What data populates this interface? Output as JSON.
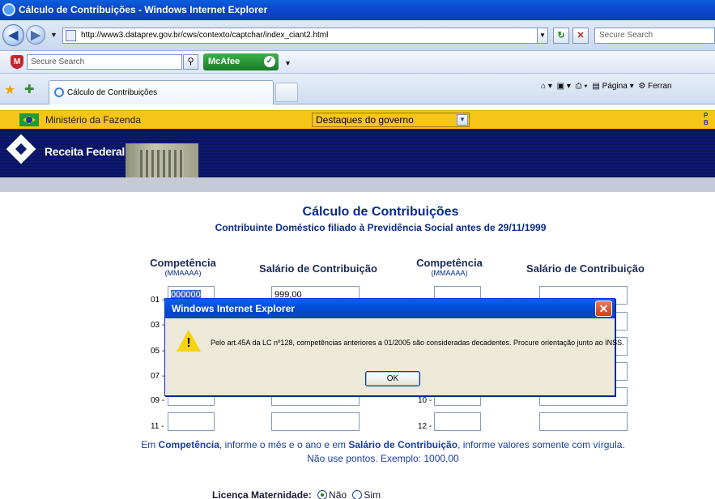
{
  "browser": {
    "window_title": "Cálculo de Contribuições - Windows Internet Explorer",
    "url": "http://www3.dataprev.gov.br/cws/contexto/captchar/index_ciant2.html",
    "search_placeholder": "Secure Search",
    "toolbar_search_placeholder": "Secure Search",
    "mcafee_label": "McAfee",
    "tab_title": "Cálculo de Contribuições",
    "cmd_pagina": "Página",
    "cmd_ferramentas": "Ferran"
  },
  "site": {
    "ministry": "Ministério da Fazenda",
    "gov_select": "Destaques do governo",
    "gov_corner": "P\nB",
    "agency": "Receita Federal"
  },
  "main": {
    "title": "Cálculo de Contribuições",
    "subtitle": "Contribuinte Doméstico filiado à Previdência Social antes de 29/11/1999",
    "col_competencia": "Competência",
    "col_competencia_fmt": "(MMAAAA)",
    "col_salario": "Salário de Contribuição",
    "rows_left": [
      "01 -",
      "03 -",
      "05 -",
      "07 -",
      "09 -",
      "11 -"
    ],
    "rows_right": [
      "10 -",
      "12 -"
    ],
    "field_01_comp": "000000",
    "field_01_sal": "999,00",
    "instructions_line1_parts": [
      "Em ",
      "Competência",
      ", informe o mês e o ano e em ",
      "Salário de Contribuição",
      ", informe valores somente com vírgula."
    ],
    "instructions_line2": "Não use pontos. Exemplo: 1000,00",
    "licenca_label": "Licença Maternidade:",
    "licenca_nao": "Não",
    "licenca_sim": "Sim"
  },
  "dialog": {
    "title": "Windows Internet Explorer",
    "message": "Pelo art.45A da LC nº128, competências anteriores a 01/2005 são consideradas decadentes. Procure orientação junto ao INSS.",
    "ok_label": "OK",
    "icon": "warning-icon"
  }
}
